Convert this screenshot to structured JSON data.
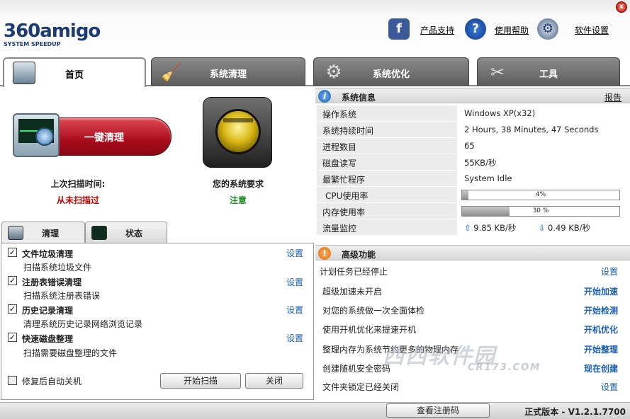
{
  "window": {
    "close_glyph": "x"
  },
  "logo": {
    "main": "360amigo",
    "sub": "SYSTEM SPEEDUP"
  },
  "header_links": {
    "support": "产品支持",
    "help": "使用帮助",
    "settings": "软件设置"
  },
  "tabs": [
    {
      "label": "首页",
      "icon": "monitor-icon"
    },
    {
      "label": "系统清理",
      "icon": "broom-icon"
    },
    {
      "label": "系统优化",
      "icon": "gears-icon"
    },
    {
      "label": "工具",
      "icon": "tools-icon"
    }
  ],
  "home": {
    "oneclick_label": "一键清理",
    "last_scan_label": "上次扫描时间:",
    "last_scan_value": "从未扫描过",
    "system_req_label": "您的系统要求",
    "system_req_value": "注意"
  },
  "subtabs": [
    {
      "label": "清理"
    },
    {
      "label": "状态"
    }
  ],
  "clean_items": [
    {
      "title": "文件垃圾清理",
      "desc": "扫描系统垃圾文件",
      "action": "设置",
      "checked": true
    },
    {
      "title": "注册表错误清理",
      "desc": "扫描系统注册表错误",
      "action": "设置",
      "checked": true
    },
    {
      "title": "历史记录清理",
      "desc": "清理系统历史记录网络浏览记录",
      "action": "设置",
      "checked": true
    },
    {
      "title": "快速磁盘整理",
      "desc": "扫描需要磁盘整理的文件",
      "action": "设置",
      "checked": true
    }
  ],
  "auto_shutdown": {
    "label": "修复后自动关机",
    "checked": false
  },
  "buttons": {
    "start_scan": "开始扫描",
    "close": "关闭"
  },
  "sysinfo": {
    "title": "系统信息",
    "report": "报告",
    "rows": [
      {
        "key": "操作系统",
        "value": "Windows XP(x32)"
      },
      {
        "key": "系统持续时间",
        "value": "2 Hours, 38 Minutes, 47 Seconds"
      },
      {
        "key": "进程数目",
        "value": "65"
      },
      {
        "key": "磁盘读写",
        "value": "55KB/秒"
      },
      {
        "key": "最繁忙程序",
        "value": "System Idle"
      }
    ],
    "cpu": {
      "key": "CPU使用率",
      "text": "4%",
      "fraction": 0.04
    },
    "mem": {
      "key": "内存使用率",
      "text": "30 %",
      "fraction": 0.3
    },
    "traffic": {
      "key": "流量监控",
      "up": "9.85 KB/秒",
      "down": "0.49 KB/秒"
    }
  },
  "advanced": {
    "title": "高级功能",
    "rows": [
      {
        "text": "计划任务已经停止",
        "action": "设置",
        "bold": false
      },
      {
        "text": "超级加速未开启",
        "action": "开始加速",
        "bold": true
      },
      {
        "text": "对您的系统做一次全面体检",
        "action": "开始检测",
        "bold": true
      },
      {
        "text": "使用开机优化来提速开机",
        "action": "开机优化",
        "bold": true
      },
      {
        "text": "整理内存为系统节约更多的物理内存",
        "action": "开始整理",
        "bold": true
      },
      {
        "text": "创建随机安全密码",
        "action": "现在创建",
        "bold": true
      },
      {
        "text": "文件夹锁定已经关闭",
        "action": "设置",
        "bold": false
      }
    ]
  },
  "watermark": {
    "main": "西西软件园",
    "small": "CR173.COM"
  },
  "footer": {
    "register_button": "查看注册码",
    "version": "正式版本 - V1.2.1.7700"
  },
  "colors": {
    "accent_blue": "#1a5fb4",
    "alert_red": "#c00000",
    "ok_green": "#1a8a1a"
  }
}
